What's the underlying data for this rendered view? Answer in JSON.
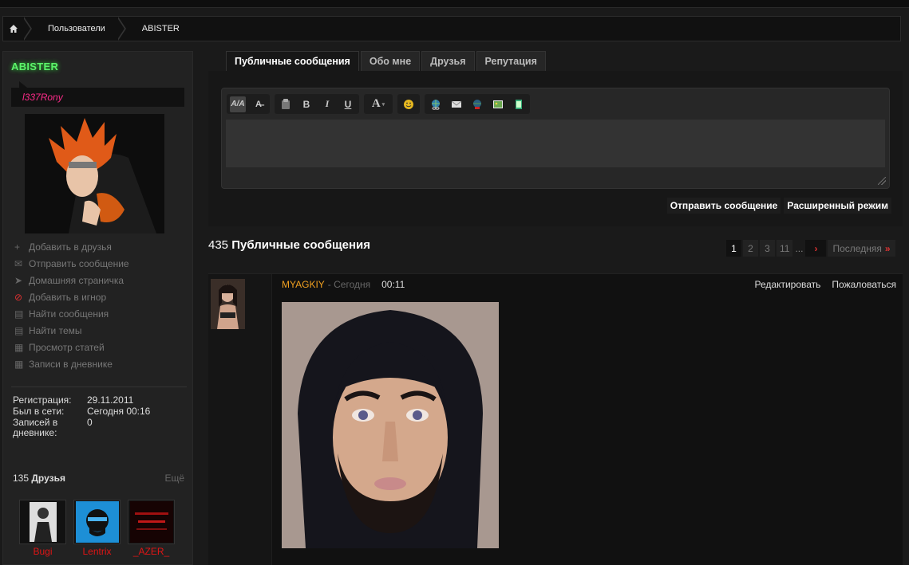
{
  "breadcrumb": {
    "items": [
      "Пользователи",
      "ABISTER"
    ]
  },
  "sidebar": {
    "username": "ABISTER",
    "usertitle": "l337Rony",
    "actions": [
      {
        "label": "Добавить в друзья",
        "icon": "plus-icon"
      },
      {
        "label": "Отправить сообщение",
        "icon": "envelope-icon"
      },
      {
        "label": "Домашняя страничка",
        "icon": "cursor-icon"
      },
      {
        "label": "Добавить в игнор",
        "icon": "block-icon"
      },
      {
        "label": "Найти сообщения",
        "icon": "posts-icon"
      },
      {
        "label": "Найти темы",
        "icon": "threads-icon"
      },
      {
        "label": "Просмотр статей",
        "icon": "article-icon"
      },
      {
        "label": "Записи в дневнике",
        "icon": "diary-icon"
      }
    ],
    "stats": [
      {
        "key": "Регистрация:",
        "value": "29.11.2011"
      },
      {
        "key": "Был в сети:",
        "value": "Сегодня 00:16"
      },
      {
        "key": "Записей в дневнике:",
        "value": "0"
      }
    ],
    "friends": {
      "count": "135",
      "label": "Друзья",
      "more": "Ещё",
      "items": [
        "Bugi",
        "Lentrix",
        "_AZER_"
      ]
    }
  },
  "tabs": [
    "Публичные сообщения",
    "Обо мне",
    "Друзья",
    "Репутация"
  ],
  "editor": {
    "send_label": "Отправить сообщение",
    "advanced_label": "Расширенный режим"
  },
  "messages": {
    "count": "435",
    "title": "Публичные сообщения",
    "pagination": [
      "1",
      "2",
      "3",
      "11"
    ],
    "last_label": "Последняя",
    "item": {
      "author": "MYAGKIY",
      "date": "- Сегодня",
      "time": "00:11",
      "edit_label": "Редактировать",
      "report_label": "Пожаловаться"
    }
  }
}
